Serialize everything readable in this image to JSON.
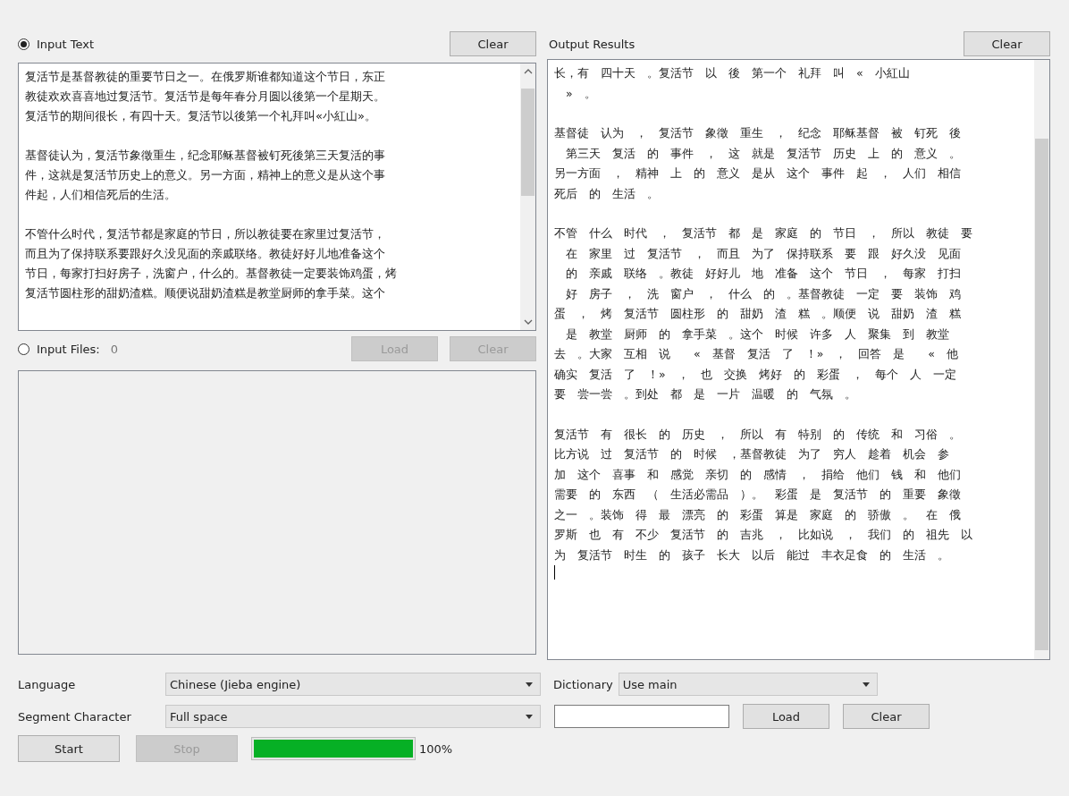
{
  "input_text": {
    "label": "Input Text",
    "selected": true,
    "clear_button": "Clear",
    "paragraphs": [
      [
        "复活节是基督教徒的重要节日之一。在俄罗斯谁都知道这个节日，东正",
        "教徒欢欢喜喜地过复活节。复活节是每年春分月圆以後第一个星期天。",
        "复活节的期间很长，有四十天。复活节以後第一个礼拜叫«小紅山»。"
      ],
      [
        "基督徒认为，复活节象徵重生，纪念耶稣基督被钉死後第三天复活的事",
        "件，这就是复活节历史上的意义。另一方面，精神上的意义是从这个事",
        "件起，人们相信死后的生活。"
      ],
      [
        "不管什么时代，复活节都是家庭的节日，所以教徒要在家里过复活节，",
        "而且为了保持联系要跟好久没见面的亲戚联络。教徒好好儿地准备这个",
        "节日，每家打扫好房子，洗窗户，什么的。基督教徒一定要装饰鸡蛋，烤",
        "复活节圆柱形的甜奶渣糕。顺便说甜奶渣糕是教堂厨师的拿手菜。这个"
      ]
    ]
  },
  "input_files": {
    "label": "Input Files:",
    "count": "0",
    "selected": false,
    "load_button": {
      "label": "Load",
      "disabled": true
    },
    "clear_button": {
      "label": "Clear",
      "disabled": true
    }
  },
  "output": {
    "label": "Output Results",
    "clear_button": "Clear",
    "paragraphs": [
      [
        "长，有　四十天　。复活节　以　後　第一个　礼拜　叫　«　小紅山",
        "　»　。"
      ],
      [
        "基督徒　认为　，　复活节　象徵　重生　，　纪念　耶稣基督　被　钉死　後",
        "　第三天　复活　的　事件　，　这　就是　复活节　历史　上　的　意义　。",
        "另一方面　，　精神　上　的　意义　是从　这个　事件　起　，　人们　相信",
        "死后　的　生活　。"
      ],
      [
        "不管　什么　时代　，　复活节　都　是　家庭　的　节日　，　所以　教徒　要",
        "　在　家里　过　复活节　，　而且　为了　保持联系　要　跟　好久没　见面",
        "　的　亲戚　联络　。教徒　好好儿　地　准备　这个　节日　，　每家　打扫",
        "　好　房子　，　洗　窗户　，　什么　的　。基督教徒　一定　要　装饰　鸡",
        "蛋　，　烤　复活节　圆柱形　的　甜奶　渣　糕　。顺便　说　甜奶　渣　糕",
        "　是　教堂　厨师　的　拿手菜　。这个　时候　许多　人　聚集　到　教堂",
        "去　。大家　互相　说　　«　基督　复活　了　！»　，　回答　是　　«　他",
        "确实　复活　了　！»　，　也　交换　烤好　的　彩蛋　，　每个　人　一定",
        "要　尝一尝　。到处　都　是　一片　温暖　的　气氛　。"
      ],
      [
        "复活节　有　很长　的　历史　，　所以　有　特别　的　传统　和　习俗　。",
        "比方说　过　复活节　的　时候　，基督教徒　为了　穷人　趁着　机会　参",
        "加　这个　喜事　和　感觉　亲切　的　感情　，　捐给　他们　钱　和　他们",
        "需要　的　东西　（　生活必需品　）。　彩蛋　是　复活节　的　重要　象徵",
        "之一　。装饰　得　最　漂亮　的　彩蛋　算是　家庭　的　骄傲　。　在　俄",
        "罗斯　也　有　不少　复活节　的　吉兆　，　比如说　，　我们　的　祖先　以",
        "为　复活节　时生　的　孩子　长大　以后　能过　丰衣足食　的　生活　。"
      ]
    ]
  },
  "language": {
    "label": "Language",
    "value": "Chinese (Jieba engine)"
  },
  "dictionary": {
    "label": "Dictionary",
    "value": "Use main",
    "load_button": "Load",
    "clear_button": "Clear"
  },
  "segment_character": {
    "label": "Segment Character",
    "value": "Full space"
  },
  "start_button": {
    "label": "Start",
    "disabled": false
  },
  "stop_button": {
    "label": "Stop",
    "disabled": true
  },
  "progress": {
    "level": 1,
    "reading": "100%"
  }
}
